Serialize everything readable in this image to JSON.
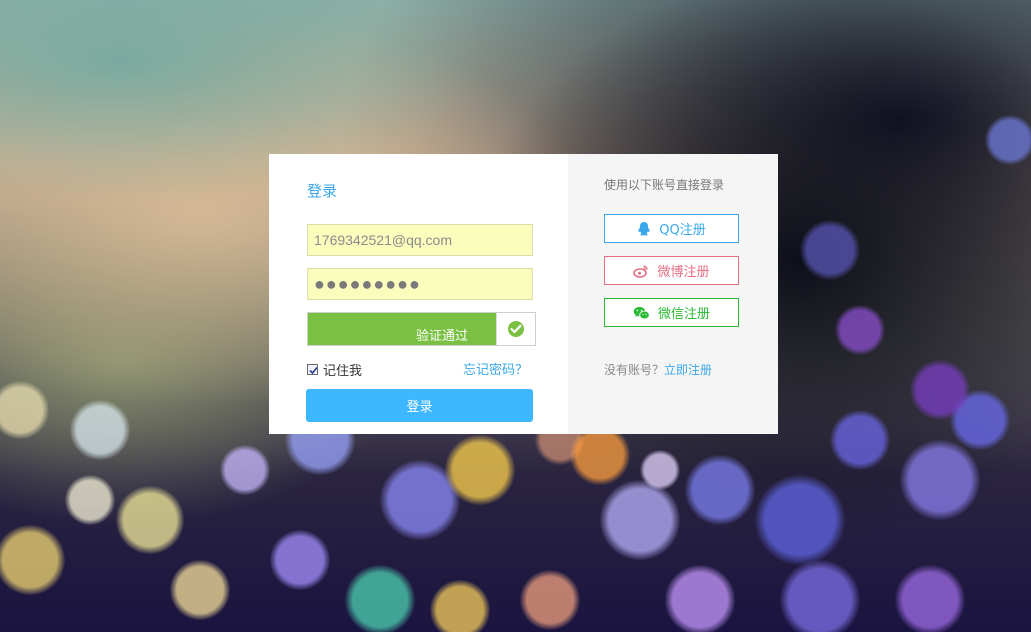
{
  "login": {
    "title": "登录",
    "email_value": "1769342521@qq.com",
    "password_mask": "●●●●●●●●●",
    "verify_label": "验证通过",
    "remember_label": "记住我",
    "forgot_label": "忘记密码？",
    "submit_label": "登录"
  },
  "social": {
    "title": "使用以下账号直接登录",
    "qq_label": "QQ注册",
    "weibo_label": "微博注册",
    "wechat_label": "微信注册"
  },
  "register": {
    "prefix": "没有账号？",
    "link_label": "立即注册"
  },
  "colors": {
    "accent_blue": "#3aa8e8",
    "login_button": "#3db7ff",
    "verify_green": "#7ac143",
    "weibo_red": "#e56e84",
    "wechat_green": "#2bbb34",
    "input_bg": "#fbfdbd"
  },
  "icons": [
    "check-icon",
    "qq-icon",
    "weibo-icon",
    "wechat-icon",
    "checkbox-checked"
  ]
}
